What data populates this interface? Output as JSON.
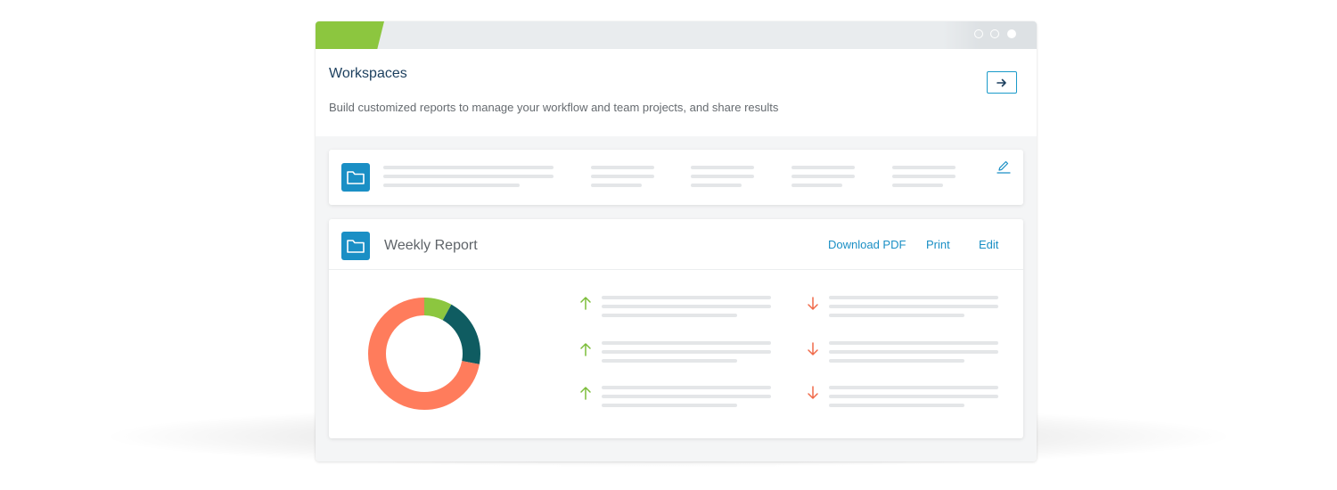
{
  "colors": {
    "brand_green": "#8cc63f",
    "accent_blue": "#1a8fc5",
    "title_navy": "#1c3f5e",
    "donut_orange": "#ff7c5c",
    "donut_green": "#8cc63f",
    "donut_teal": "#0f5c61",
    "arrow_up": "#7cbd3a",
    "arrow_down": "#f06a4a"
  },
  "window": {
    "controls": [
      "window-dot",
      "window-dot",
      "window-dot-active"
    ]
  },
  "header": {
    "title": "Workspaces",
    "subtitle": "Build customized reports to manage your workflow and team projects, and share results",
    "go_icon": "arrow-right-icon"
  },
  "collapsed_workspace": {
    "icon": "folder-icon",
    "edit_icon": "pencil-icon"
  },
  "report": {
    "icon": "folder-icon",
    "title": "Weekly Report",
    "actions": {
      "download": "Download PDF",
      "print": "Print",
      "edit": "Edit"
    },
    "indicators": {
      "left_column": [
        "arrow-up-icon",
        "arrow-up-icon",
        "arrow-up-icon"
      ],
      "right_column": [
        "arrow-down-icon",
        "arrow-down-icon",
        "arrow-down-icon"
      ]
    }
  },
  "chart_data": {
    "type": "pie",
    "donut": true,
    "series": [
      {
        "value": 8,
        "color": "#8cc63f"
      },
      {
        "value": 20,
        "color": "#0f5c61"
      },
      {
        "value": 72,
        "color": "#ff7c5c"
      }
    ]
  }
}
